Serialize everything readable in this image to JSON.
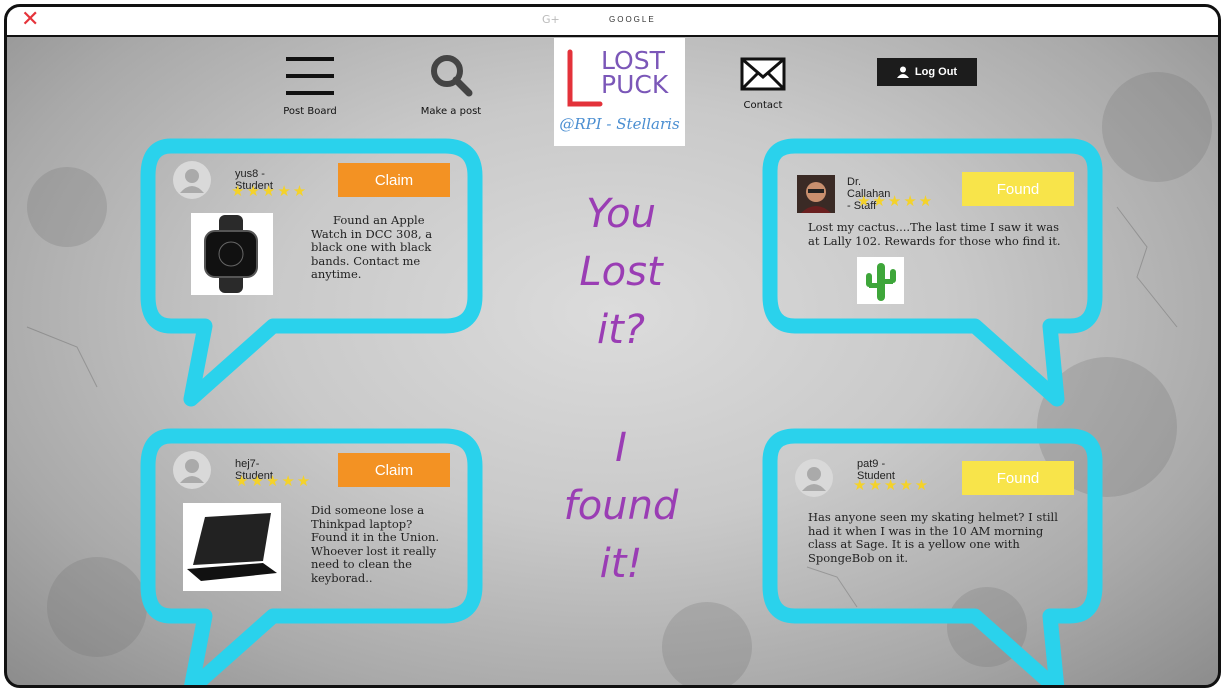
{
  "window": {
    "title": "GOOGLE",
    "gplus": "G+"
  },
  "nav": {
    "post_board": "Post Board",
    "make_post": "Make a post",
    "contact": "Contact",
    "logout": "Log Out"
  },
  "logo": {
    "line1": "LOST",
    "line2": "PUCK",
    "handle": "@RPI - Stellaris"
  },
  "slogan": {
    "line1": "You",
    "line2": "Lost",
    "line3": "it?",
    "line4": "I",
    "line5": "found",
    "line6": "it!"
  },
  "posts": [
    {
      "user": "yus8 - Student",
      "stars": "★★★★★",
      "action": "Claim",
      "text": "Found an Apple Watch in DCC 308, a black one with black bands. Contact me anytime."
    },
    {
      "user": "Dr. Callahan - Staff",
      "stars": "★★★★★",
      "action": "Found",
      "text": "Lost my cactus....The last time I saw it was at Lally 102. Rewards for those who find it."
    },
    {
      "user": "hej7- Student",
      "stars": "★★★★★",
      "action": "Claim",
      "text": "Did someone lose a Thinkpad laptop? Found it in the Union. Whoever lost it really need to clean the keyborad.."
    },
    {
      "user": "pat9 - Student",
      "stars": "★★★★★",
      "action": "Found",
      "text": "Has anyone seen my skating helmet? I still had it when I was in the 10 AM morning class at Sage. It is a yellow one with SpongeBob on it."
    }
  ],
  "colors": {
    "bubble": "#2ad2ec",
    "claim": "#f39223",
    "found": "#f8e44a",
    "slogan": "#9a3db4",
    "close": "#e5333a"
  }
}
